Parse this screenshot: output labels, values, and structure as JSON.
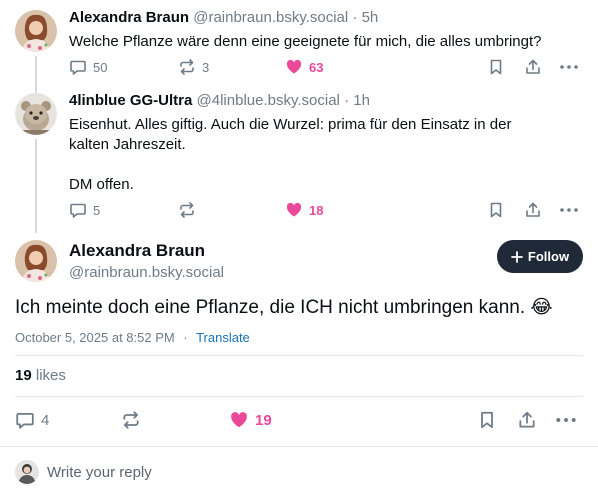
{
  "colors": {
    "like": "#ec4899",
    "muted": "#6f7b86",
    "follow_bg": "#1f2937",
    "link": "#1a73b8"
  },
  "posts": [
    {
      "author_name": "Alexandra Braun",
      "handle": "@rainbraun.bsky.social",
      "separator": "·",
      "age": "5h",
      "lines": [
        "Welche Pflanze wäre denn eine geeignete für mich, die alles umbringt?"
      ],
      "reply_count": "50",
      "repost_count": "3",
      "like_count": "63"
    },
    {
      "author_name": "4linblue GG-Ultra",
      "handle": "@4linblue.bsky.social",
      "separator": "·",
      "age": "1h",
      "lines": [
        "Eisenhut. Alles giftig. Auch die Wurzel: prima für den Einsatz in der",
        "kalten Jahreszeit.",
        "DM offen."
      ],
      "reply_count": "5",
      "repost_count": "",
      "like_count": "18"
    }
  ],
  "main_post": {
    "author_name": "Alexandra Braun",
    "handle": "@rainbraun.bsky.social",
    "follow_label": "Follow",
    "text": "Ich meinte doch eine Pflanze, die ICH nicht umbringen kann. 😂",
    "timestamp": "October 5, 2025 at 8:52 PM",
    "separator": "·",
    "translate_label": "Translate",
    "likes_count": "19",
    "likes_label": "likes",
    "reply_count": "4",
    "like_count": "19"
  },
  "reply_bar": {
    "placeholder": "Write your reply"
  },
  "icons": [
    "reply-icon",
    "repost-icon",
    "heart-icon",
    "bookmark-icon",
    "share-icon",
    "more-icon",
    "plus-icon"
  ]
}
